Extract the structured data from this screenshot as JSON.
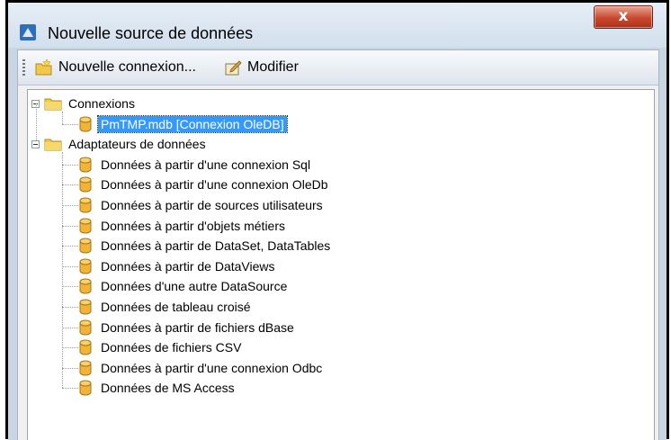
{
  "window": {
    "title": "Nouvelle source de données",
    "close_glyph": "x"
  },
  "toolbar": {
    "new_connection_label": "Nouvelle connexion...",
    "modify_label": "Modifier"
  },
  "tree": {
    "connexions_label": "Connexions",
    "connections": [
      {
        "label": "PmTMP.mdb [Connexion OleDB]",
        "selected": true
      }
    ],
    "adapters_label": "Adaptateurs de données",
    "adapters": [
      "Données à partir d'une connexion Sql",
      "Données à partir d'une connexion OleDb",
      "Données à partir de sources utilisateurs",
      "Données à partir d'objets métiers",
      "Données à partir de DataSet, DataTables",
      "Données à partir de DataViews",
      "Données d'une autre DataSource",
      "Données de tableau croisé",
      "Données à partir de fichiers dBase",
      "Données de fichiers CSV",
      "Données à partir d'une connexion Odbc",
      "Données de MS Access"
    ]
  },
  "icons": {
    "app": "database-source-icon",
    "folder": "folder-icon",
    "database": "database-cylinder-icon",
    "new_connection": "new-connection-icon",
    "modify": "modify-icon"
  },
  "colors": {
    "selection": "#3399ff",
    "folder": "#f2c84b",
    "database": "#f2b436",
    "close_button": "#c8482f"
  }
}
